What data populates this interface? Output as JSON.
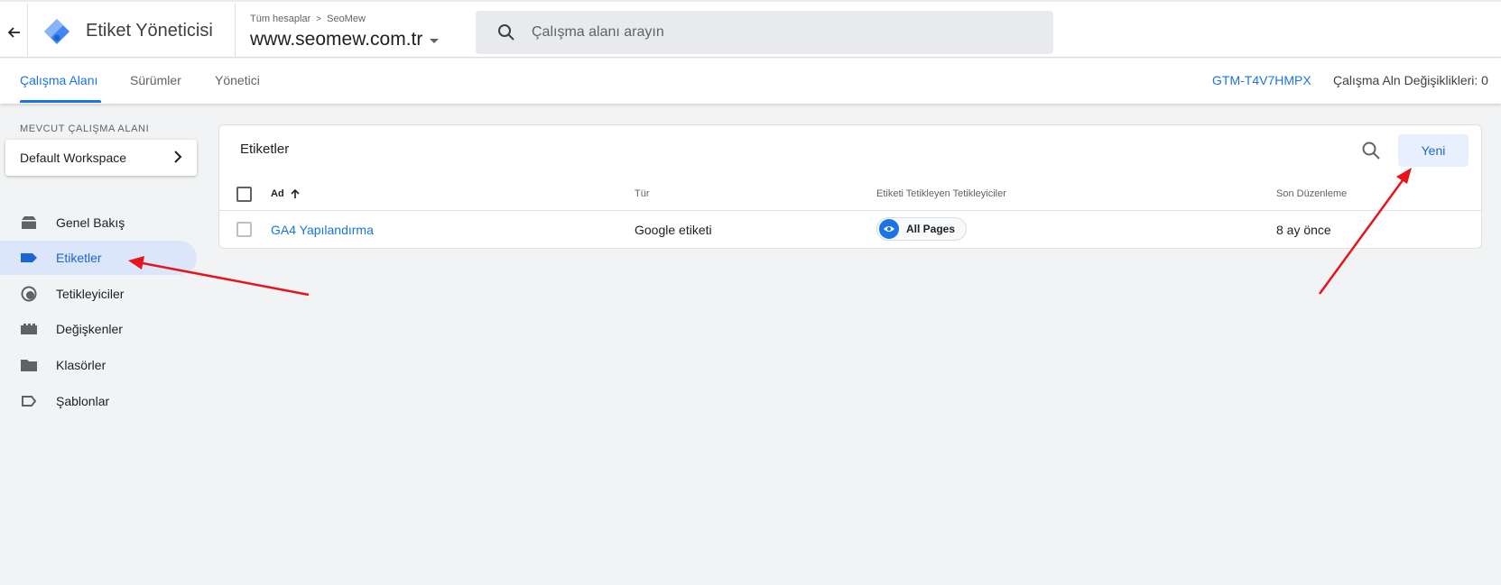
{
  "header": {
    "app_title": "Etiket Yöneticisi",
    "account_breadcrumb": [
      "Tüm hesaplar",
      "SeoMew"
    ],
    "container_name": "www.seomew.com.tr",
    "search_placeholder": "Çalışma alanı arayın"
  },
  "tabs": [
    {
      "label": "Çalışma Alanı",
      "active": true
    },
    {
      "label": "Sürümler",
      "active": false
    },
    {
      "label": "Yönetici",
      "active": false
    }
  ],
  "container_id": "GTM-T4V7HMPX",
  "workspace_changes": "Çalışma Aln Değişiklikleri: 0",
  "sidebar": {
    "workspace_label": "MEVCUT ÇALIŞMA ALANI",
    "workspace_name": "Default Workspace",
    "items": [
      {
        "label": "Genel Bakış",
        "icon": "overview-icon",
        "active": false
      },
      {
        "label": "Etiketler",
        "icon": "tag-icon",
        "active": true
      },
      {
        "label": "Tetikleyiciler",
        "icon": "trigger-icon",
        "active": false
      },
      {
        "label": "Değişkenler",
        "icon": "variables-icon",
        "active": false
      },
      {
        "label": "Klasörler",
        "icon": "folder-icon",
        "active": false
      },
      {
        "label": "Şablonlar",
        "icon": "template-icon",
        "active": false
      }
    ]
  },
  "main": {
    "title": "Etiketler",
    "new_button": "Yeni",
    "columns": [
      "Ad",
      "Tür",
      "Etiketi Tetikleyen Tetikleyiciler",
      "Son Düzenleme"
    ],
    "rows": [
      {
        "name": "GA4 Yapılandırma",
        "type": "Google etiketi",
        "trigger": "All Pages",
        "last_edit": "8 ay önce"
      }
    ]
  },
  "colors": {
    "accent": "#1a73e8",
    "annotation_arrow": "#e8141b"
  }
}
